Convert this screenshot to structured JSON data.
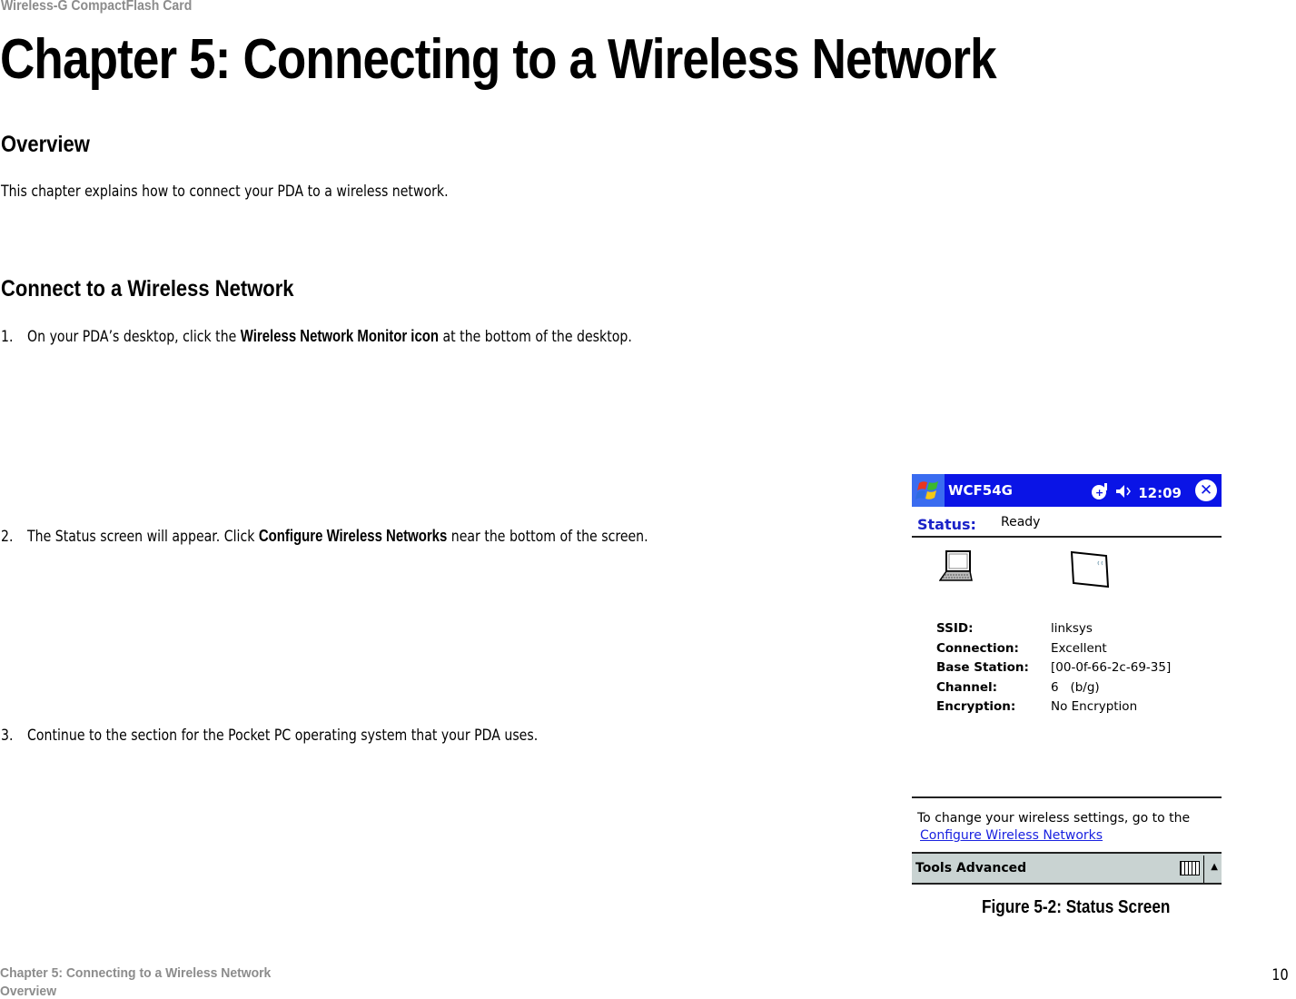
{
  "header": {
    "running_title": "Wireless-G CompactFlash Card"
  },
  "chapter_title": "Chapter 5: Connecting to a Wireless Network",
  "sections": {
    "overview": {
      "heading": "Overview",
      "text": "This chapter explains how to connect your PDA to a wireless network."
    },
    "connect": {
      "heading": "Connect to a Wireless Network",
      "steps": [
        {
          "num": "1.",
          "before": "On your PDA’s desktop, click the ",
          "bold": "Wireless Network Monitor icon",
          "after": " at the bottom of the desktop."
        },
        {
          "num": "2.",
          "before": "The Status screen will appear. Click ",
          "bold": "Configure Wireless Networks",
          "after": " near the bottom of the screen."
        },
        {
          "num": "3.",
          "before": "Continue to the section for the Pocket PC operating system that your PDA uses.",
          "bold": "",
          "after": ""
        }
      ]
    }
  },
  "figure": {
    "caption": "Figure 5-2: Status Screen",
    "pda": {
      "app_title": "WCF54G",
      "time": "12:09",
      "tray_icons": [
        "connectivity-icon",
        "speaker-icon"
      ],
      "status_label": "Status:",
      "status_value": "Ready",
      "info": [
        {
          "key": "SSID:",
          "value": "linksys"
        },
        {
          "key": "Connection:",
          "value": "Excellent"
        },
        {
          "key": "Base Station:",
          "value": "[00-0f-66-2c-69-35]"
        },
        {
          "key": "Channel:",
          "value": "6   (b/g)"
        },
        {
          "key": "Encryption:",
          "value": "No Encryption"
        }
      ],
      "hint_text": "To change your wireless settings, go to the",
      "hint_link": "Configure Wireless Networks",
      "menu": "Tools Advanced",
      "colors": {
        "titlebar": "#0a14e6",
        "status_label": "#1a22c8",
        "menubar": "#c9d3d2",
        "link": "#1a22e0"
      }
    }
  },
  "footer": {
    "line1": "Chapter 5: Connecting to a Wireless Network",
    "line2": "Overview",
    "page_number": "10"
  }
}
